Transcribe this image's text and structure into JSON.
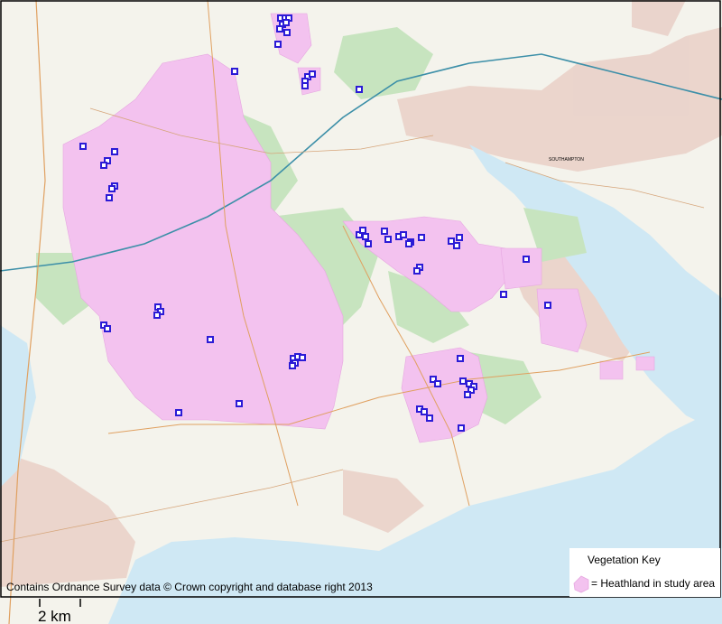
{
  "map": {
    "attribution": "Contains Ordnance Survey data © Crown copyright and database right 2013",
    "scale_bar_label": "2 km",
    "place_label": "SOUTHAMPTON",
    "colors": {
      "land": "#f4f3ec",
      "water": "#cfe8f4",
      "woodland": "#c7e4bf",
      "heathland": "#f3c2ef",
      "urban": "#ead1c9",
      "road_primary": "#e0a060",
      "road_motorway": "#3c8fa8",
      "site_marker": "#2b1bd6"
    }
  },
  "legend": {
    "title": "Vegetation Key",
    "items": [
      {
        "label": "= Heathland in study area",
        "swatch_color": "#f3c2ef"
      }
    ]
  },
  "study_sites": {
    "count": 78,
    "marker_color": "#2b1bd6"
  }
}
